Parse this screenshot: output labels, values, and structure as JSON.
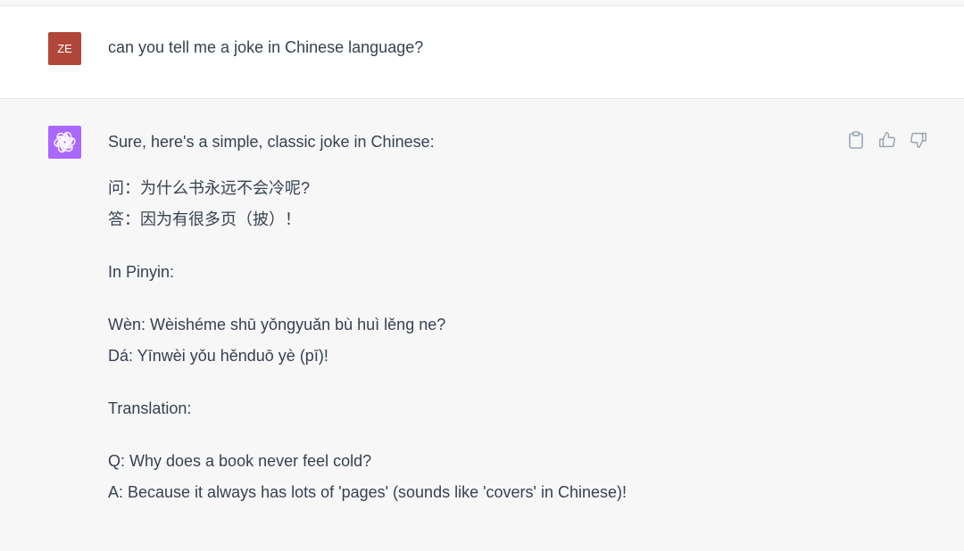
{
  "user_message": {
    "avatar_initials": "ZE",
    "text": "can you tell me a joke in Chinese language?"
  },
  "assistant_message": {
    "intro": "Sure, here's a simple, classic joke in Chinese:",
    "chinese_q": "问：为什么书永远不会冷呢?",
    "chinese_a": "答：因为有很多页（披）！",
    "pinyin_label": "In Pinyin:",
    "pinyin_q": "Wèn: Wèishéme shū yǒngyuǎn bù huì lěng ne?",
    "pinyin_a": "Dá: Yīnwèi yǒu hěnduō yè (pī)!",
    "translation_label": "Translation:",
    "translation_q": "Q: Why does a book never feel cold?",
    "translation_a": "A: Because it always has lots of 'pages' (sounds like 'covers' in Chinese)!"
  },
  "colors": {
    "user_avatar": "#b1473a",
    "assistant_avatar": "#ab68ff",
    "assistant_bg": "#f7f7f8",
    "text": "#374151",
    "icon": "#9ca3af"
  },
  "icons": {
    "assistant_logo": "openai-logo-icon",
    "copy": "clipboard-icon",
    "like": "thumbs-up-icon",
    "dislike": "thumbs-down-icon"
  }
}
